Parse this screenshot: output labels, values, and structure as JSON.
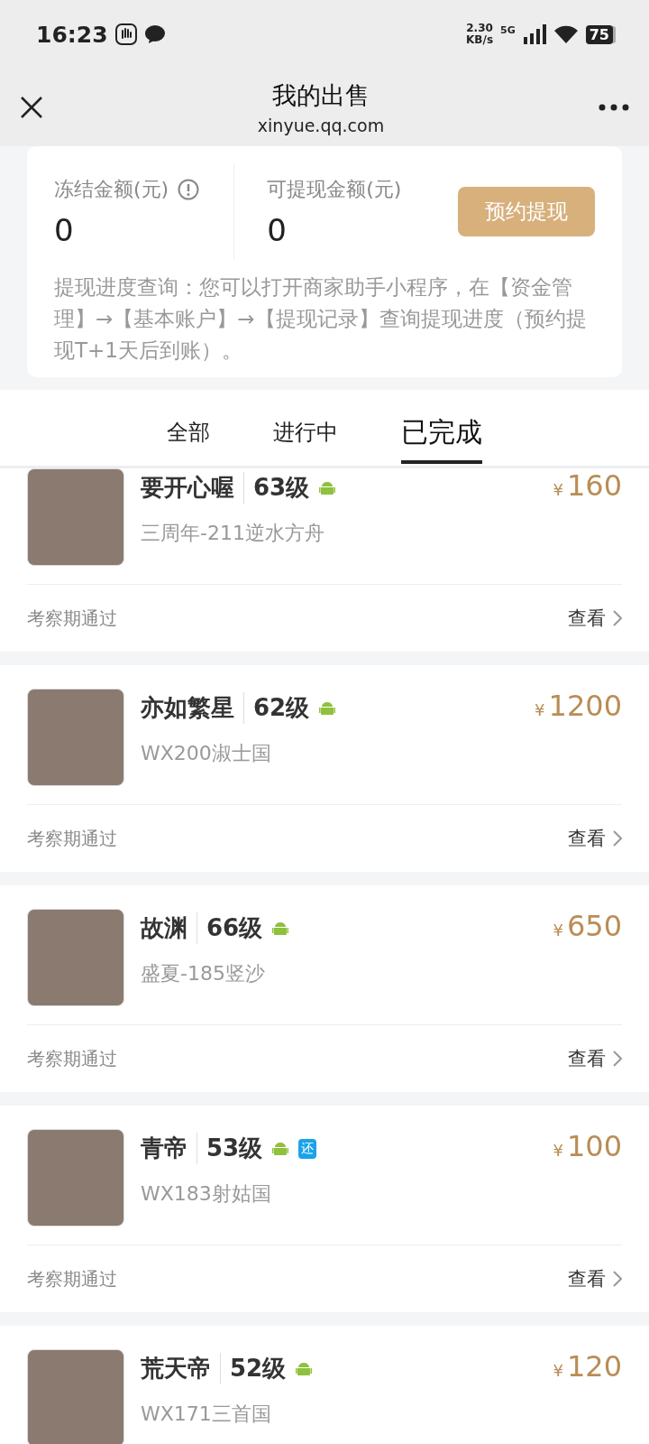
{
  "status_bar": {
    "time": "16:23",
    "speed_value": "2.30",
    "speed_unit": "KB/s",
    "network": "5G",
    "battery": "75"
  },
  "header": {
    "title": "我的出售",
    "subtitle": "xinyue.qq.com"
  },
  "balance": {
    "frozen_label": "冻结金额(元)",
    "frozen_value": "0",
    "available_label": "可提现金额(元)",
    "available_value": "0",
    "withdraw_button": "预约提现",
    "note": "提现进度查询：您可以打开商家助手小程序，在【资金管理】→【基本账户】→【提现记录】查询提现进度（预约提现T+1天后到账）。"
  },
  "tabs": [
    {
      "label": "全部",
      "selected": false
    },
    {
      "label": "进行中",
      "selected": false
    },
    {
      "label": "已完成",
      "selected": true
    }
  ],
  "orders": [
    {
      "name": "要开心喔",
      "level": "63级",
      "android": true,
      "server": "三周年-211逆水方舟",
      "currency": "¥",
      "price": "160",
      "status": "考察期通过",
      "action": "查看"
    },
    {
      "name": "亦如繁星",
      "level": "62级",
      "android": true,
      "server": "WX200淑士国",
      "currency": "¥",
      "price": "1200",
      "status": "考察期通过",
      "action": "查看"
    },
    {
      "name": "故渊",
      "level": "66级",
      "android": true,
      "server": "盛夏-185竖沙",
      "currency": "¥",
      "price": "650",
      "status": "考察期通过",
      "action": "查看"
    },
    {
      "name": "青帝",
      "level": "53级",
      "android": true,
      "badge": "还",
      "server": "WX183射姑国",
      "currency": "¥",
      "price": "100",
      "status": "考察期通过",
      "action": "查看"
    },
    {
      "name": "荒天帝",
      "level": "52级",
      "android": true,
      "server": "WX171三首国",
      "currency": "¥",
      "price": "120"
    }
  ]
}
